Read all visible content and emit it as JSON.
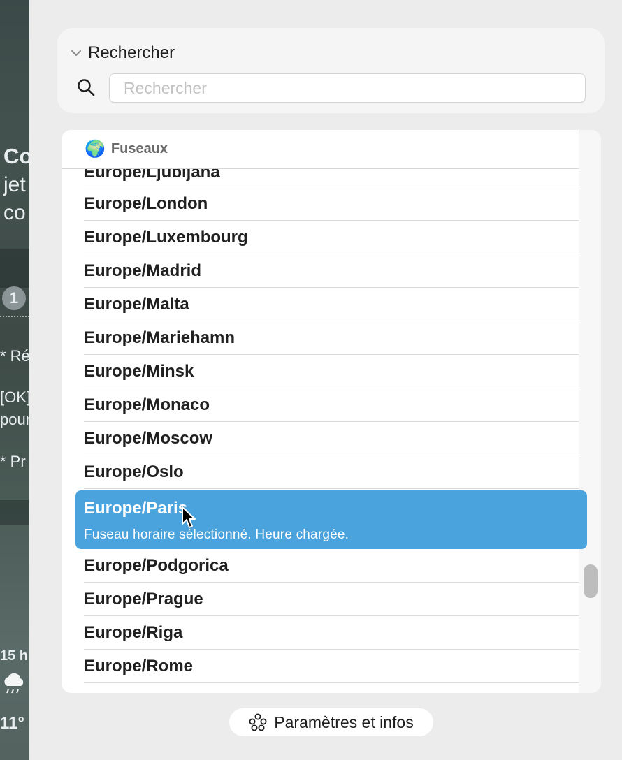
{
  "background_window": {
    "title_fragment": "Co",
    "subtitle_line1": "jet",
    "subtitle_line2": "co",
    "step_number": "1",
    "line_r": "* Ré",
    "line_ok": "[OK]",
    "line_pour": "pour",
    "line_pr": "* Pr",
    "hour_label": "15 h",
    "weather_icon": "cloud-rain-icon",
    "temperature": "11°"
  },
  "search": {
    "title": "Rechercher",
    "placeholder": "Rechercher",
    "value": ""
  },
  "list": {
    "header_label": "Fuseaux",
    "header_icon": "globe-icon",
    "items_above": [
      "Europe/Ljubljana",
      "Europe/London",
      "Europe/Luxembourg",
      "Europe/Madrid",
      "Europe/Malta",
      "Europe/Mariehamn",
      "Europe/Minsk",
      "Europe/Monaco",
      "Europe/Moscow",
      "Europe/Oslo"
    ],
    "selected": {
      "name": "Europe/Paris",
      "status": "Fuseau horaire sélectionné. Heure chargée."
    },
    "items_below": [
      "Europe/Podgorica",
      "Europe/Prague",
      "Europe/Riga",
      "Europe/Rome"
    ]
  },
  "footer": {
    "button_label": "Paramètres et infos",
    "button_icon": "settings-cluster-icon"
  },
  "colors": {
    "selection": "#4aa3dc",
    "window_bg": "#ececec",
    "panel_bg": "#f5f5f5"
  }
}
